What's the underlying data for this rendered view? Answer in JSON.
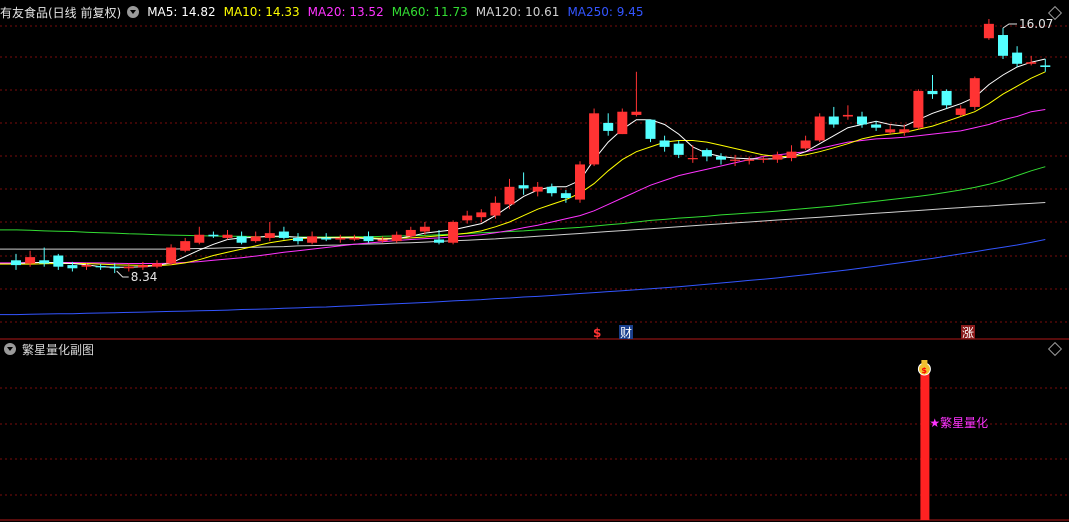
{
  "header": {
    "title": "有友食品(日线 前复权)",
    "ma": [
      {
        "label": "MA5: 14.82",
        "color": "#ffffff"
      },
      {
        "label": "MA10: 14.33",
        "color": "#ffff00"
      },
      {
        "label": "MA20: 13.52",
        "color": "#ff33ff"
      },
      {
        "label": "MA60: 11.73",
        "color": "#33dd33"
      },
      {
        "label": "MA120: 10.61",
        "color": "#d0d0d0"
      },
      {
        "label": "MA250: 9.45",
        "color": "#3355ff"
      }
    ]
  },
  "sub_panel": {
    "title": "繁星量化副图",
    "signal_label": "★繁星量化",
    "signal_color": "#ff2222",
    "label_color": "#ff33ff"
  },
  "markers": {
    "dollar": "$",
    "cai": "财",
    "zhang": "涨"
  },
  "chart_data": {
    "type": "candlestick",
    "price_range": [
      8.34,
      16.07
    ],
    "annotations": {
      "high": "16.07",
      "low": "8.34"
    },
    "up_color": "#ff3333",
    "down_color": "#54ffff",
    "candles": [
      [
        8.8,
        8.65,
        9.0,
        8.5
      ],
      [
        8.7,
        8.9,
        9.1,
        8.6
      ],
      [
        8.8,
        8.7,
        9.2,
        8.6
      ],
      [
        8.95,
        8.6,
        9.0,
        8.5
      ],
      [
        8.65,
        8.55,
        8.75,
        8.45
      ],
      [
        8.6,
        8.65,
        8.7,
        8.5
      ],
      [
        8.62,
        8.58,
        8.68,
        8.5
      ],
      [
        8.6,
        8.55,
        8.7,
        8.4
      ],
      [
        8.55,
        8.6,
        8.7,
        8.45
      ],
      [
        8.58,
        8.65,
        8.75,
        8.5
      ],
      [
        8.6,
        8.7,
        8.8,
        8.55
      ],
      [
        8.7,
        9.2,
        9.3,
        8.65
      ],
      [
        9.1,
        9.4,
        9.5,
        9.05
      ],
      [
        9.35,
        9.6,
        9.85,
        9.3
      ],
      [
        9.6,
        9.55,
        9.7,
        9.5
      ],
      [
        9.5,
        9.6,
        9.75,
        9.45
      ],
      [
        9.55,
        9.35,
        9.7,
        9.3
      ],
      [
        9.4,
        9.55,
        9.7,
        9.35
      ],
      [
        9.5,
        9.65,
        10.0,
        9.4
      ],
      [
        9.7,
        9.5,
        9.85,
        9.45
      ],
      [
        9.5,
        9.4,
        9.65,
        9.3
      ],
      [
        9.35,
        9.55,
        9.7,
        9.3
      ],
      [
        9.5,
        9.45,
        9.65,
        9.4
      ],
      [
        9.45,
        9.5,
        9.6,
        9.35
      ],
      [
        9.45,
        9.5,
        9.6,
        9.4
      ],
      [
        9.55,
        9.4,
        9.7,
        9.35
      ],
      [
        9.4,
        9.45,
        9.55,
        9.35
      ],
      [
        9.4,
        9.6,
        9.7,
        9.35
      ],
      [
        9.55,
        9.75,
        9.85,
        9.5
      ],
      [
        9.7,
        9.85,
        10.0,
        9.6
      ],
      [
        9.45,
        9.35,
        9.75,
        9.3
      ],
      [
        9.35,
        10.0,
        10.05,
        9.3
      ],
      [
        10.05,
        10.2,
        10.35,
        9.95
      ],
      [
        10.15,
        10.3,
        10.4,
        10.0
      ],
      [
        10.2,
        10.6,
        10.8,
        10.1
      ],
      [
        10.55,
        11.1,
        11.35,
        10.4
      ],
      [
        11.15,
        11.05,
        11.55,
        10.85
      ],
      [
        10.95,
        11.1,
        11.25,
        10.8
      ],
      [
        11.1,
        10.9,
        11.2,
        10.8
      ],
      [
        10.9,
        10.75,
        11.0,
        10.6
      ],
      [
        10.7,
        11.8,
        11.9,
        10.6
      ],
      [
        11.8,
        13.4,
        13.55,
        11.75
      ],
      [
        13.1,
        12.85,
        13.4,
        12.7
      ],
      [
        12.75,
        13.45,
        13.55,
        12.75
      ],
      [
        13.35,
        13.45,
        14.7,
        13.3
      ],
      [
        13.2,
        12.6,
        13.2,
        12.5
      ],
      [
        12.55,
        12.35,
        12.7,
        12.2
      ],
      [
        12.45,
        12.1,
        12.55,
        12.0
      ],
      [
        12.0,
        12.0,
        12.4,
        11.85
      ],
      [
        12.25,
        12.05,
        12.3,
        11.9
      ],
      [
        12.05,
        11.95,
        12.15,
        11.8
      ],
      [
        11.95,
        11.95,
        12.1,
        11.75
      ],
      [
        11.95,
        11.95,
        12.05,
        11.8
      ],
      [
        11.95,
        11.98,
        12.05,
        11.85
      ],
      [
        11.95,
        12.1,
        12.2,
        11.85
      ],
      [
        12.0,
        12.2,
        12.4,
        11.9
      ],
      [
        12.3,
        12.55,
        12.7,
        12.25
      ],
      [
        12.55,
        13.3,
        13.4,
        12.5
      ],
      [
        13.3,
        13.05,
        13.6,
        12.95
      ],
      [
        13.3,
        13.35,
        13.65,
        13.2
      ],
      [
        13.3,
        13.05,
        13.45,
        12.95
      ],
      [
        13.05,
        12.95,
        13.15,
        12.85
      ],
      [
        12.8,
        12.9,
        13.05,
        12.75
      ],
      [
        12.8,
        12.9,
        13.05,
        12.7
      ],
      [
        12.95,
        14.1,
        14.15,
        12.9
      ],
      [
        14.1,
        14.0,
        14.6,
        13.85
      ],
      [
        14.1,
        13.65,
        14.15,
        13.55
      ],
      [
        13.35,
        13.55,
        13.65,
        13.3
      ],
      [
        13.6,
        14.5,
        14.55,
        13.5
      ],
      [
        15.75,
        16.2,
        16.35,
        15.7
      ],
      [
        15.85,
        15.2,
        16.07,
        15.1
      ],
      [
        15.3,
        14.95,
        15.5,
        14.85
      ],
      [
        14.95,
        15.0,
        15.2,
        14.9
      ],
      [
        14.9,
        14.85,
        15.1,
        14.7
      ]
    ],
    "series": [
      {
        "name": "MA5",
        "color": "#ffffff",
        "values": [
          8.7,
          8.72,
          8.74,
          8.72,
          8.7,
          8.66,
          8.6,
          8.58,
          8.58,
          8.6,
          8.64,
          8.72,
          8.92,
          9.12,
          9.3,
          9.45,
          9.5,
          9.52,
          9.55,
          9.55,
          9.52,
          9.5,
          9.5,
          9.5,
          9.5,
          9.48,
          9.46,
          9.48,
          9.55,
          9.65,
          9.7,
          9.75,
          9.85,
          9.95,
          10.2,
          10.5,
          10.8,
          11.0,
          11.1,
          11.1,
          11.3,
          11.95,
          12.5,
          12.9,
          13.2,
          13.2,
          13.05,
          12.75,
          12.35,
          12.15,
          12.05,
          12.0,
          11.98,
          11.97,
          11.98,
          12.05,
          12.2,
          12.45,
          12.7,
          12.95,
          13.05,
          13.15,
          13.05,
          13.0,
          13.2,
          13.4,
          13.55,
          13.7,
          13.9,
          14.3,
          14.6,
          14.85,
          15.0,
          15.1
        ]
      },
      {
        "name": "MA10",
        "color": "#ffff00",
        "values": [
          8.68,
          8.68,
          8.69,
          8.7,
          8.7,
          8.7,
          8.68,
          8.66,
          8.65,
          8.64,
          8.63,
          8.66,
          8.72,
          8.82,
          8.95,
          9.05,
          9.15,
          9.25,
          9.35,
          9.42,
          9.48,
          9.5,
          9.51,
          9.52,
          9.52,
          9.5,
          9.49,
          9.49,
          9.5,
          9.53,
          9.57,
          9.6,
          9.65,
          9.72,
          9.85,
          10.0,
          10.2,
          10.4,
          10.55,
          10.7,
          10.9,
          11.2,
          11.6,
          11.95,
          12.2,
          12.35,
          12.5,
          12.55,
          12.55,
          12.5,
          12.4,
          12.3,
          12.2,
          12.1,
          12.05,
          12.05,
          12.1,
          12.2,
          12.32,
          12.45,
          12.6,
          12.7,
          12.75,
          12.8,
          12.9,
          13.0,
          13.15,
          13.3,
          13.45,
          13.7,
          14.0,
          14.25,
          14.5,
          14.7
        ]
      },
      {
        "name": "MA20",
        "color": "#ff33ff",
        "values": [
          8.72,
          8.73,
          8.73,
          8.73,
          8.73,
          8.72,
          8.72,
          8.71,
          8.7,
          8.7,
          8.7,
          8.71,
          8.73,
          8.76,
          8.8,
          8.84,
          8.88,
          8.93,
          8.99,
          9.05,
          9.1,
          9.15,
          9.2,
          9.25,
          9.3,
          9.34,
          9.38,
          9.42,
          9.45,
          9.48,
          9.5,
          9.53,
          9.56,
          9.6,
          9.66,
          9.73,
          9.82,
          9.9,
          10.0,
          10.1,
          10.2,
          10.35,
          10.55,
          10.75,
          10.95,
          11.15,
          11.3,
          11.45,
          11.55,
          11.65,
          11.75,
          11.85,
          11.95,
          12.05,
          12.1,
          12.15,
          12.2,
          12.3,
          12.4,
          12.5,
          12.55,
          12.6,
          12.62,
          12.65,
          12.7,
          12.75,
          12.8,
          12.85,
          12.95,
          13.05,
          13.2,
          13.3,
          13.45,
          13.52
        ]
      },
      {
        "name": "MA60",
        "color": "#33dd33",
        "values": [
          9.75,
          9.74,
          9.72,
          9.71,
          9.7,
          9.68,
          9.66,
          9.65,
          9.63,
          9.62,
          9.6,
          9.59,
          9.58,
          9.57,
          9.56,
          9.55,
          9.55,
          9.54,
          9.54,
          9.53,
          9.53,
          9.53,
          9.53,
          9.53,
          9.54,
          9.54,
          9.55,
          9.56,
          9.57,
          9.58,
          9.6,
          9.62,
          9.64,
          9.66,
          9.68,
          9.7,
          9.72,
          9.75,
          9.77,
          9.8,
          9.83,
          9.87,
          9.91,
          9.95,
          10.0,
          10.05,
          10.08,
          10.12,
          10.15,
          10.18,
          10.22,
          10.25,
          10.28,
          10.31,
          10.34,
          10.38,
          10.42,
          10.46,
          10.5,
          10.55,
          10.6,
          10.65,
          10.7,
          10.75,
          10.8,
          10.86,
          10.93,
          11.0,
          11.08,
          11.18,
          11.3,
          11.45,
          11.6,
          11.73
        ]
      },
      {
        "name": "MA120",
        "color": "#d0d0d0",
        "values": [
          9.15,
          9.15,
          9.15,
          9.15,
          9.15,
          9.15,
          9.15,
          9.15,
          9.15,
          9.15,
          9.15,
          9.15,
          9.16,
          9.17,
          9.18,
          9.19,
          9.2,
          9.21,
          9.22,
          9.23,
          9.25,
          9.26,
          9.27,
          9.28,
          9.3,
          9.31,
          9.32,
          9.34,
          9.35,
          9.37,
          9.39,
          9.41,
          9.43,
          9.45,
          9.47,
          9.5,
          9.52,
          9.55,
          9.58,
          9.61,
          9.64,
          9.67,
          9.7,
          9.73,
          9.76,
          9.79,
          9.82,
          9.85,
          9.88,
          9.91,
          9.94,
          9.97,
          10.0,
          10.03,
          10.06,
          10.09,
          10.12,
          10.15,
          10.18,
          10.21,
          10.24,
          10.27,
          10.3,
          10.33,
          10.36,
          10.39,
          10.42,
          10.45,
          10.48,
          10.5,
          10.53,
          10.56,
          10.58,
          10.61
        ]
      },
      {
        "name": "MA250",
        "color": "#3355ff",
        "values": [
          7.1,
          7.11,
          7.12,
          7.13,
          7.13,
          7.14,
          7.15,
          7.16,
          7.17,
          7.18,
          7.19,
          7.2,
          7.21,
          7.22,
          7.23,
          7.24,
          7.26,
          7.27,
          7.28,
          7.3,
          7.31,
          7.33,
          7.34,
          7.36,
          7.38,
          7.4,
          7.42,
          7.44,
          7.46,
          7.48,
          7.5,
          7.53,
          7.55,
          7.57,
          7.6,
          7.62,
          7.65,
          7.67,
          7.7,
          7.73,
          7.76,
          7.79,
          7.82,
          7.85,
          7.88,
          7.91,
          7.94,
          7.97,
          8.01,
          8.05,
          8.09,
          8.13,
          8.17,
          8.21,
          8.25,
          8.3,
          8.35,
          8.4,
          8.45,
          8.5,
          8.56,
          8.62,
          8.68,
          8.74,
          8.8,
          8.86,
          8.93,
          9.0,
          9.07,
          9.14,
          9.21,
          9.28,
          9.36,
          9.45
        ]
      }
    ],
    "signal": {
      "index": 64
    }
  }
}
